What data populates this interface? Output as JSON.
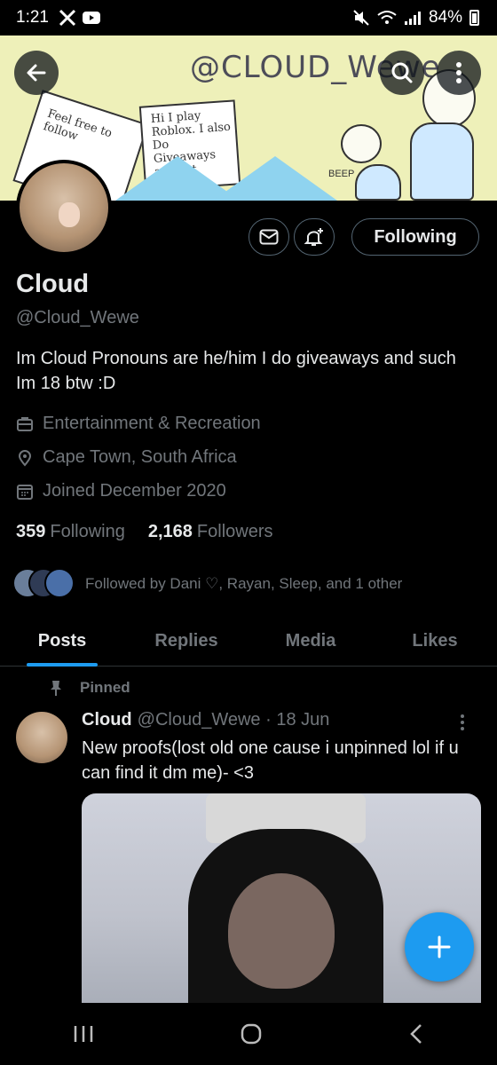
{
  "status_bar": {
    "time": "1:21",
    "battery": "84%"
  },
  "banner": {
    "handle_art": "@CLOUD_Wewe",
    "sign1_text": "Feel free to follow",
    "sign2_text": "Hi I play Roblox. I also Do Giveaways and art",
    "beep_text": "BEEP"
  },
  "profile": {
    "name": "Cloud",
    "handle": "@Cloud_Wewe",
    "bio": "Im Cloud Pronouns are he/him I do giveaways and such Im 18 btw :D",
    "category": "Entertainment & Recreation",
    "location": "Cape Town, South Africa",
    "joined": "Joined December 2020",
    "following_count": "359",
    "following_label": "Following",
    "followers_count": "2,168",
    "followers_label": "Followers",
    "followed_by": "Followed by Dani ♡, Rayan, Sleep, and 1 other"
  },
  "buttons": {
    "following": "Following"
  },
  "tabs": [
    {
      "label": "Posts",
      "active": true
    },
    {
      "label": "Replies",
      "active": false
    },
    {
      "label": "Media",
      "active": false
    },
    {
      "label": "Likes",
      "active": false
    }
  ],
  "post": {
    "pinned_label": "Pinned",
    "author": "Cloud",
    "meta": "@Cloud_Wewe · 18 Jun",
    "text": "New proofs(lost old one cause i unpinned lol if u can find it dm me)- <3"
  },
  "colors": {
    "accent": "#1d9bf0",
    "background": "#000000",
    "muted": "#71767b",
    "text": "#e7e9ea"
  },
  "icons": [
    "x-logo-icon",
    "youtube-icon",
    "mute-icon",
    "wifi-icon",
    "signal-icon",
    "battery-icon",
    "back-arrow-icon",
    "search-icon",
    "more-vertical-icon",
    "envelope-icon",
    "bell-plus-icon",
    "briefcase-icon",
    "location-pin-icon",
    "calendar-icon",
    "pin-icon",
    "plus-icon",
    "recent-apps-icon",
    "home-icon",
    "nav-back-icon"
  ]
}
